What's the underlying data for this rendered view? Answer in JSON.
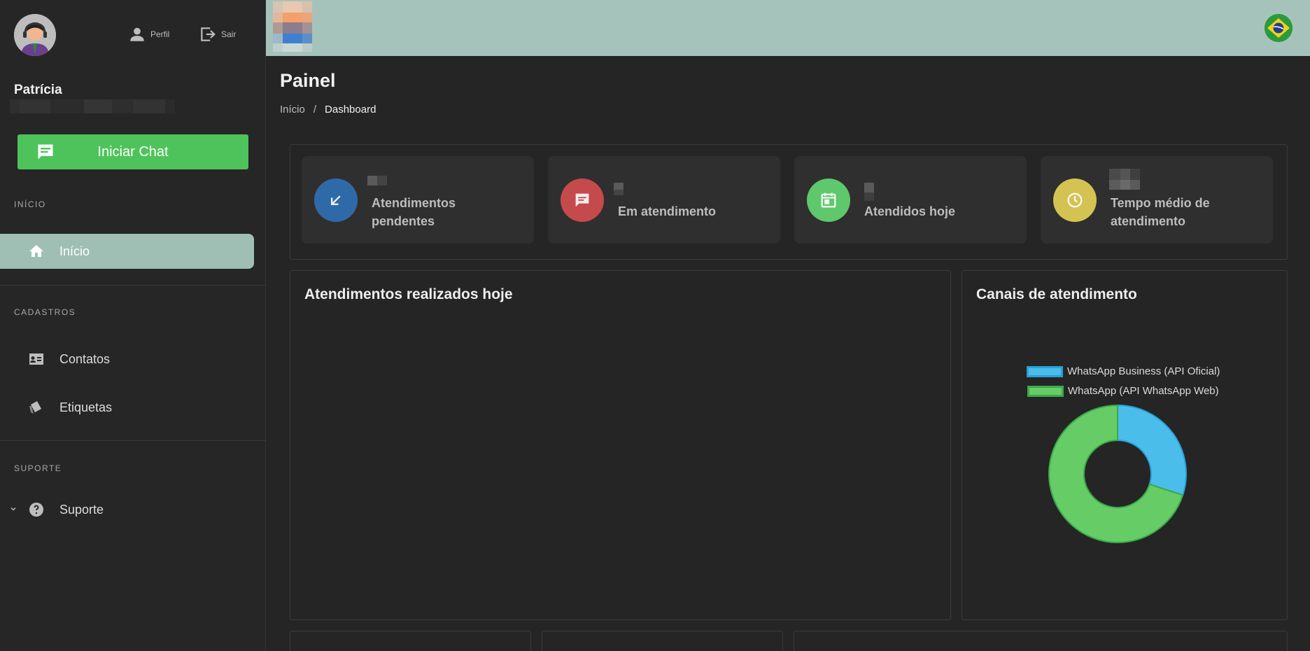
{
  "sidebar": {
    "user_name": "Patrícia",
    "profile_label": "Perfil",
    "logout_label": "Sair",
    "start_chat_label": "Iniciar Chat",
    "sections": {
      "inicio": "INÍCIO",
      "cadastros": "CADASTROS",
      "suporte": "SUPORTE"
    },
    "items": {
      "inicio": "Início",
      "contatos": "Contatos",
      "etiquetas": "Etiquetas",
      "suporte": "Suporte"
    }
  },
  "header": {
    "page_title": "Painel",
    "breadcrumb_home": "Início",
    "breadcrumb_sep": "/",
    "breadcrumb_current": "Dashboard"
  },
  "stats": [
    {
      "label_line1": "Atendimentos",
      "label_line2": "pendentes",
      "color": "#2f6aa8",
      "icon": "arrow-down-left-icon"
    },
    {
      "label_line1": "Em atendimento",
      "label_line2": "",
      "color": "#c54a4c",
      "icon": "chat-icon"
    },
    {
      "label_line1": "Atendidos hoje",
      "label_line2": "",
      "color": "#5fc76c",
      "icon": "calendar-icon"
    },
    {
      "label_line1": "Tempo médio de",
      "label_line2": "atendimento",
      "color": "#d4c253",
      "icon": "clock-icon"
    }
  ],
  "panels": {
    "today_title": "Atendimentos realizados hoje",
    "channels_title": "Canais de atendimento"
  },
  "chart_data": {
    "type": "pie",
    "categories": [
      "WhatsApp Business (API Oficial)",
      "WhatsApp (API WhatsApp Web)"
    ],
    "values": [
      30,
      70
    ],
    "colors": [
      "#4bbdeb",
      "#66cc66"
    ],
    "donut": true,
    "legend_position": "top"
  },
  "colors": {
    "accent": "#a6c3bb",
    "primary_button": "#4ec35c"
  }
}
